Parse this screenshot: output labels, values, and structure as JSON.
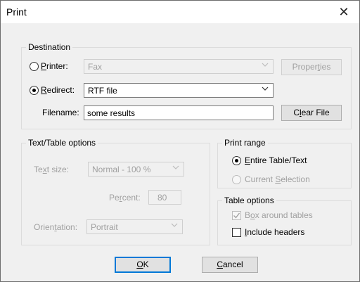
{
  "window": {
    "title": "Print"
  },
  "destination": {
    "legend": "Destination",
    "printer_label_pre": "",
    "printer_label_u": "P",
    "printer_label_post": "rinter:",
    "printer_value": "Fax",
    "properties_pre": "Proper",
    "properties_u": "t",
    "properties_post": "ies",
    "redirect_label_u": "R",
    "redirect_label_post": "edirect:",
    "redirect_value": "RTF file",
    "filename_label": "Filename:",
    "filename_value": "some results",
    "clear_pre": "C",
    "clear_u": "l",
    "clear_post": "ear File"
  },
  "text_table": {
    "legend": "Text/Table options",
    "text_size_pre": "Te",
    "text_size_u": "x",
    "text_size_post": "t size:",
    "text_size_value": "Normal - 100 %",
    "percent_pre": "Pe",
    "percent_u": "r",
    "percent_post": "cent:",
    "percent_value": "80",
    "orientation_pre": "Orien",
    "orientation_u": "t",
    "orientation_post": "ation:",
    "orientation_value": "Portrait"
  },
  "print_range": {
    "legend": "Print range",
    "entire_u": "E",
    "entire_post": "ntire Table/Text",
    "current_pre": "Current ",
    "current_u": "S",
    "current_post": "election"
  },
  "table_options": {
    "legend": "Table options",
    "box_pre": "B",
    "box_u": "o",
    "box_post": "x around tables",
    "headers_u": "I",
    "headers_post": "nclude headers"
  },
  "buttons": {
    "ok_u": "O",
    "ok_post": "K",
    "cancel_u": "C",
    "cancel_post": "ancel"
  }
}
